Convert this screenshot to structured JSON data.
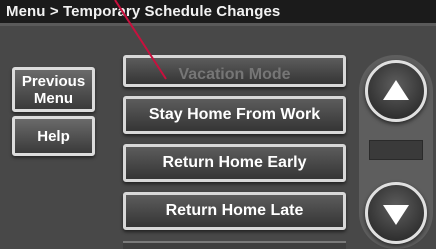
{
  "header": {
    "title": "Menu > Temporary Schedule Changes"
  },
  "sidebar": {
    "previous_menu_label": "Previous Menu",
    "help_label": "Help"
  },
  "list": {
    "items": [
      {
        "label": "Vacation Mode"
      },
      {
        "label": "Stay Home From Work"
      },
      {
        "label": "Return Home Early"
      },
      {
        "label": "Return Home Late"
      }
    ]
  },
  "scroll": {
    "up_icon": "up-arrow-icon",
    "down_icon": "down-arrow-icon"
  },
  "colors": {
    "background": "#484848",
    "title_bar": "#1b1b1b",
    "button_border": "#d8d8d8",
    "pointer": "#c8103e"
  }
}
